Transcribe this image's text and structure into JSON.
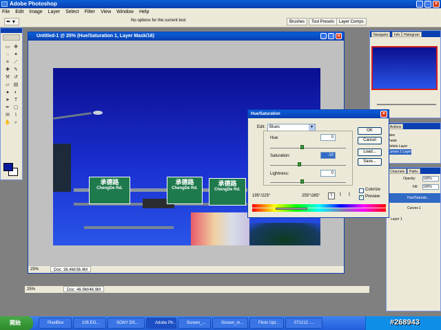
{
  "app": {
    "title": "Adobe Photoshop"
  },
  "menu": [
    "File",
    "Edit",
    "Image",
    "Layer",
    "Select",
    "Filter",
    "View",
    "Window",
    "Help"
  ],
  "options": {
    "message": "No options for the current tool."
  },
  "wells": [
    "Brushes",
    "Tool Presets",
    "Layer Comps"
  ],
  "document": {
    "title": "Untitled-1 @ 25% (Hue/Saturation 1, Layer Mask/16)",
    "zoom": "25%",
    "doc_size": "Doc: 36.4M/36.4M"
  },
  "app_status": {
    "zoom": "25%",
    "doc_size": "Doc: 46.9M/46.9M"
  },
  "image": {
    "sign1": {
      "zh": "承德路",
      "en": "ChengDe Rd."
    },
    "sign2": {
      "zh": "承德路",
      "en": "ChengDe Rd."
    },
    "sign3": {
      "zh": "承德路",
      "en": "ChengDe Rd."
    }
  },
  "hue_sat": {
    "title": "Hue/Saturation",
    "edit_label": "Edit:",
    "edit_value": "Blues",
    "hue_label": "Hue:",
    "hue_value": "0",
    "saturation_label": "Saturation:",
    "saturation_value": "-10",
    "lightness_label": "Lightness:",
    "lightness_value": "0",
    "range_left": "195°/225°",
    "range_right": "255°\\285°",
    "ok": "OK",
    "cancel": "Cancel",
    "load": "Load...",
    "save": "Save...",
    "colorize": "Colorize",
    "preview": "Preview",
    "preview_checked": true,
    "colorize_checked": false
  },
  "navigator": {
    "tabs": [
      "Navigator",
      "Info",
      "Histogram"
    ]
  },
  "history": {
    "tabs": [
      "Actions"
    ],
    "items": [
      "New",
      "Paste",
      "Delete Layer",
      "Curves 1 Layer"
    ]
  },
  "layers": {
    "tabs": [
      "Channels",
      "Paths"
    ],
    "opacity_label": "Opacity:",
    "opacity": "100%",
    "fill_label": "Fill:",
    "fill": "100%",
    "rows": [
      "Hue/Saturati...",
      "Curves 1",
      "Layer 1"
    ]
  },
  "taskbar": {
    "start": "開始",
    "buttons": [
      "PixelBox",
      "105 EO...",
      "SONY DS...",
      "Adobe Ph...",
      "Screen_...",
      "Screen_m...",
      "Flickr Upl...",
      "071212 -..."
    ],
    "watermark": "#268943"
  },
  "colors": {
    "xp_blue": "#0a3fb0",
    "sky": "#1a2fd0",
    "sign_green": "#1e7a4c"
  }
}
